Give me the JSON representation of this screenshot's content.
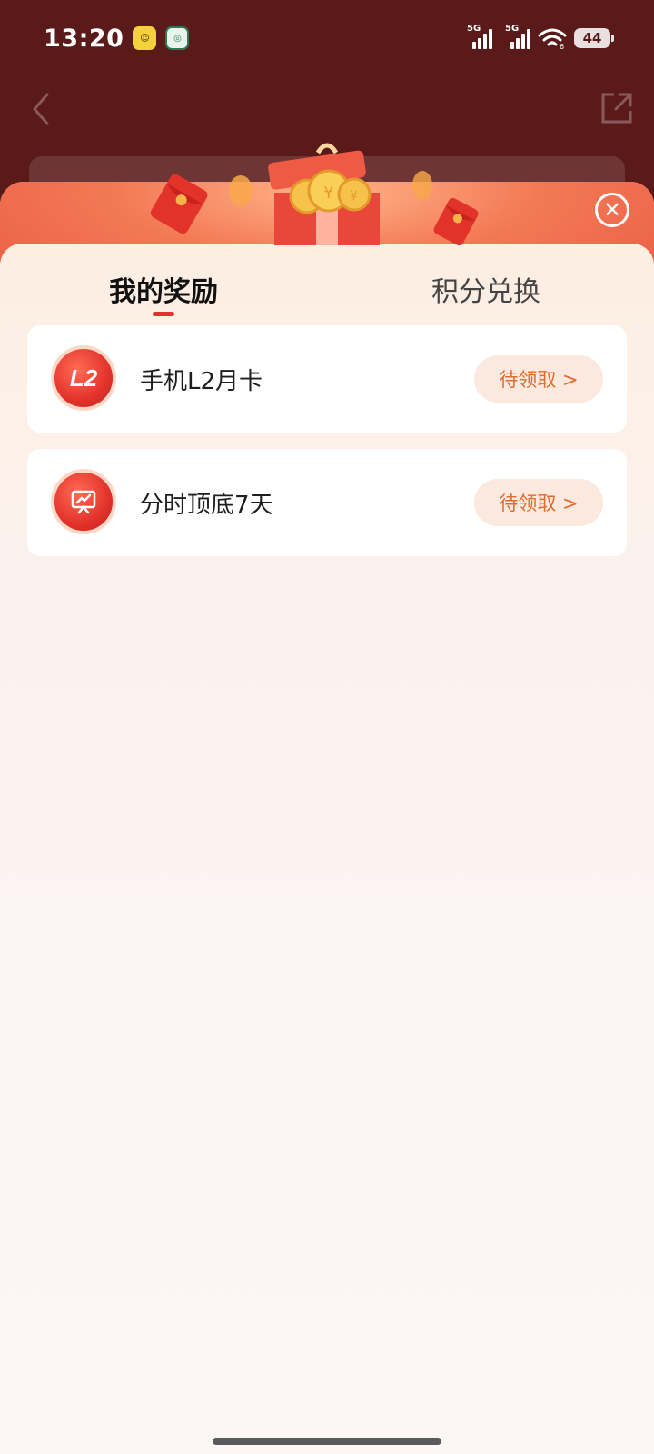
{
  "status_bar": {
    "time": "13:20",
    "app_icon_1": "sun-app-icon",
    "app_icon_2": "bank-app-icon",
    "signal_1": "5G",
    "signal_2": "5G",
    "wifi_tag": "6",
    "battery": "44"
  },
  "header": {
    "back_icon": "back-chevron-icon",
    "share_icon": "share-icon"
  },
  "sheet": {
    "close_icon": "close-icon",
    "tabs": [
      {
        "label": "我的奖励",
        "active": true
      },
      {
        "label": "积分兑换",
        "active": false
      }
    ],
    "rewards": [
      {
        "badge_text": "L2",
        "name": "手机L2月卡",
        "action": "待领取 >"
      },
      {
        "badge_icon": "chart-presentation-icon",
        "name": "分时顶底7天",
        "action": "待领取 >"
      }
    ]
  },
  "colors": {
    "page_bg": "#5a1a1a",
    "accent_red": "#e2332b",
    "claim_text": "#e26a2c",
    "claim_bg": "#fbe9df"
  }
}
